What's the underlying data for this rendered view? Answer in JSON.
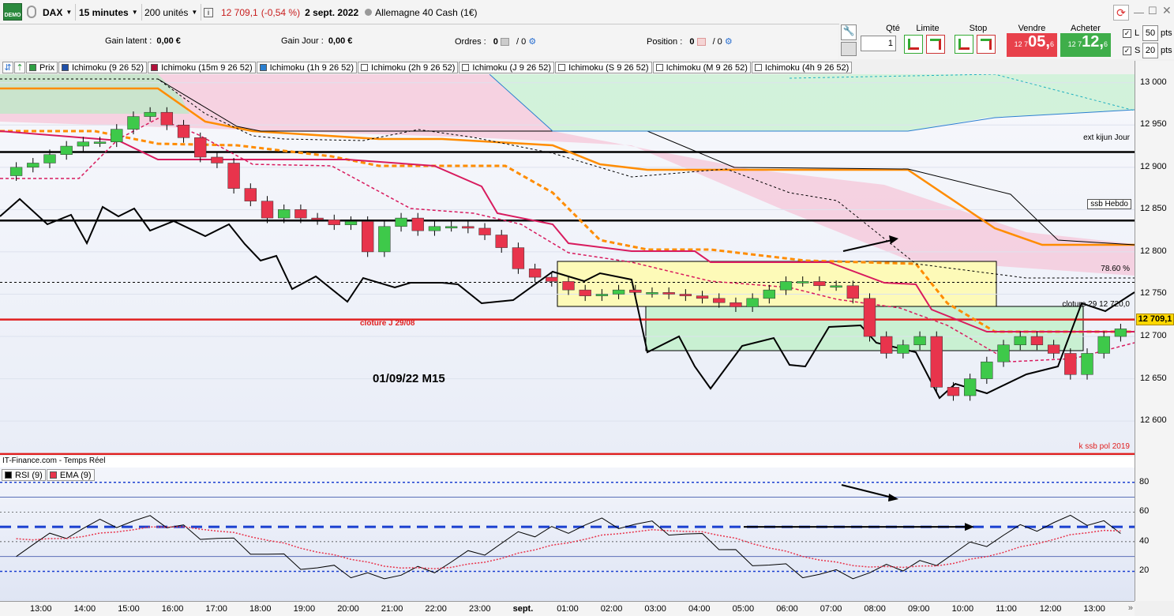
{
  "toolbar": {
    "instrument": "DAX",
    "timeframe": "15 minutes",
    "units": "200 unités",
    "quote": "12 709,1",
    "change": "(-0,54 %)",
    "date": "2 sept. 2022",
    "market": "Allemagne 40 Cash (1€)",
    "demo_badge": "DEMO"
  },
  "stats": {
    "gain_latent_label": "Gain latent :",
    "gain_latent_value": "0,00 €",
    "gain_jour_label": "Gain Jour :",
    "gain_jour_value": "0,00 €",
    "ordres_label": "Ordres :",
    "ordres_a": "0",
    "ordres_b": "/ 0",
    "position_label": "Position :",
    "position_a": "0",
    "position_b": "/ 0"
  },
  "order_panel": {
    "qte_label": "Qté",
    "qte_value": "1",
    "limite_label": "Limite",
    "stop_label": "Stop",
    "vendre_label": "Vendre",
    "vendre_small": "12 7",
    "vendre_big": "05,",
    "vendre_frac": "6",
    "acheter_label": "Acheter",
    "acheter_small": "12 7",
    "acheter_big": "12,",
    "acheter_frac": "6",
    "l_label": "L",
    "l_pts": "50",
    "s_label": "S",
    "s_pts": "20",
    "pts_label": "pts",
    "sell_color": "#e8414b",
    "buy_color": "#3fae4a"
  },
  "legend": [
    {
      "label": "Prix",
      "color": "#2ea043"
    },
    {
      "label": "Ichimoku (9 26 52)",
      "color": "#1f4fa8"
    },
    {
      "label": "Ichimoku (15m 9 26 52)",
      "color": "#b0103a"
    },
    {
      "label": "Ichimoku (1h 9 26 52)",
      "color": "#2a7fd0"
    },
    {
      "label": "Ichimoku (2h 9 26 52)",
      "color": "#ffffff"
    },
    {
      "label": "Ichimoku (J 9 26 52)",
      "color": "#ffffff"
    },
    {
      "label": "Ichimoku (S 9 26 52)",
      "color": "#ffffff"
    },
    {
      "label": "Ichimoku (M 9 26 52)",
      "color": "#ffffff"
    },
    {
      "label": "Ichimoku (4h 9 26 52)",
      "color": "#ffffff"
    }
  ],
  "annotations": {
    "ext_kijun": "ext kijun Jour",
    "ssb_hebdo": "ssb Hebdo",
    "fibo": "78.60 %",
    "cloture_29": "cloture 29 12 720,0",
    "cloture_j": "cloture J  29/08",
    "date_label": "01/09/22   M15",
    "k_ssb": "k ssb pol 2019",
    "current_price": "12 709,1"
  },
  "chart_data": [
    {
      "type": "candlestick",
      "title": "",
      "ylim": [
        12560,
        13010
      ],
      "y_ticks": [
        "13 000",
        "12 950",
        "12 900",
        "12 850",
        "12 800",
        "12 750",
        "12 700",
        "12 650",
        "12 600"
      ],
      "x_ticks": [
        "13:00",
        "14:00",
        "15:00",
        "16:00",
        "17:00",
        "18:00",
        "19:00",
        "20:00",
        "21:00",
        "22:00",
        "23:00",
        "sept.",
        "01:00",
        "02:00",
        "03:00",
        "04:00",
        "05:00",
        "06:00",
        "07:00",
        "08:00",
        "09:00",
        "10:00",
        "11:00",
        "12:00",
        "13:00"
      ],
      "horizontal_levels": [
        {
          "name": "ext kijun Jour",
          "value": 12918,
          "color": "#000000"
        },
        {
          "name": "ssb Hebdo",
          "value": 12837,
          "color": "#000000"
        },
        {
          "name": "cloture J 29/08",
          "value": 12720,
          "color": "#e02020"
        },
        {
          "name": "k ssb pol 2019",
          "value": 12561,
          "color": "#e02020"
        },
        {
          "name": "78.60 %",
          "value": 12764,
          "color": "#000000"
        }
      ],
      "closes": [
        12900,
        12905,
        12915,
        12925,
        12930,
        12930,
        12945,
        12960,
        12965,
        12950,
        12935,
        12912,
        12905,
        12875,
        12860,
        12840,
        12850,
        12840,
        12838,
        12832,
        12836,
        12800,
        12830,
        12840,
        12825,
        12830,
        12830,
        12828,
        12820,
        12805,
        12780,
        12770,
        12765,
        12755,
        12748,
        12750,
        12755,
        12752,
        12752,
        12750,
        12748,
        12745,
        12740,
        12735,
        12745,
        12755,
        12765,
        12765,
        12760,
        12760,
        12745,
        12700,
        12680,
        12690,
        12700,
        12640,
        12630,
        12650,
        12670,
        12690,
        12700,
        12690,
        12680,
        12655,
        12680,
        12700,
        12709
      ],
      "rsi_ylim": [
        0,
        90
      ],
      "rsi_ticks": [
        "80",
        "60",
        "40",
        "20"
      ],
      "series": [
        {
          "name": "RSI (9)",
          "color": "#000000"
        },
        {
          "name": "EMA (9)",
          "color": "#e8344c"
        }
      ]
    }
  ],
  "rsi_header": "IT-Finance.com - Temps Réel"
}
